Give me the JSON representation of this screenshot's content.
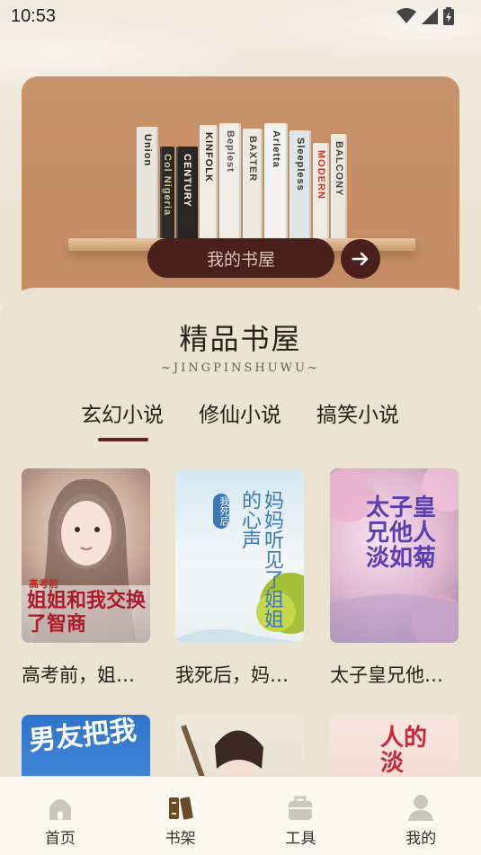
{
  "status_bar": {
    "time": "10:53"
  },
  "banner": {
    "button_label": "我的书屋",
    "books": [
      {
        "spine": "Union",
        "color": "#e9e6df",
        "text_color": "#222",
        "h": 126,
        "w": 24
      },
      {
        "spine": "Col Nigeria",
        "color": "#2c2a27",
        "text_color": "#d9c9a0",
        "h": 104,
        "w": 16
      },
      {
        "spine": "CENTURY",
        "color": "#2a2623",
        "text_color": "#ffffff",
        "h": 104,
        "w": 24
      },
      {
        "spine": "KINFOLK",
        "color": "#efece6",
        "text_color": "#222",
        "h": 128,
        "w": 20
      },
      {
        "spine": "Beplest",
        "color": "#f1eee8",
        "text_color": "#555",
        "h": 130,
        "w": 24
      },
      {
        "spine": "BAXTER",
        "color": "#ece9e2",
        "text_color": "#444",
        "h": 124,
        "w": 22
      },
      {
        "spine": "Arletta",
        "color": "#f4f2ee",
        "text_color": "#333",
        "h": 130,
        "w": 26
      },
      {
        "spine": "Sleepless",
        "color": "#dfe6e6",
        "text_color": "#333",
        "h": 122,
        "w": 24
      },
      {
        "spine": "MODERN",
        "color": "#f0ece3",
        "text_color": "#c23a2a",
        "h": 108,
        "w": 18
      },
      {
        "spine": "BALCONY",
        "color": "#ebe8e2",
        "text_color": "#444",
        "h": 118,
        "w": 18
      }
    ]
  },
  "section": {
    "title": "精品书屋",
    "subtitle": "~JINGPINSHUWU~"
  },
  "tabs": [
    {
      "label": "玄幻小说",
      "active": true
    },
    {
      "label": "修仙小说",
      "active": false
    },
    {
      "label": "搞笑小说",
      "active": false
    }
  ],
  "books": [
    {
      "title": "高考前，姐…",
      "cover_text": "姐姐和我交换了智商",
      "cover_sub": "高考前",
      "cover_bg": "#d9c6bf"
    },
    {
      "title": "我死后，妈…",
      "cover_text": "妈妈听见了姐姐的心声",
      "cover_sub": "我死后",
      "cover_bg": "#cfe2ee"
    },
    {
      "title": "太子皇兄他…",
      "cover_text": "太子皇兄他人淡如菊",
      "cover_sub": "",
      "cover_bg": "#e9d4e3"
    },
    {
      "title": "",
      "cover_text": "男友把我",
      "cover_sub": "",
      "cover_bg": "#3a7fd0"
    },
    {
      "title": "",
      "cover_text": "",
      "cover_sub": "",
      "cover_bg": "#e7e2d6"
    },
    {
      "title": "",
      "cover_text": "人的淡",
      "cover_sub": "",
      "cover_bg": "#f2d9cf"
    }
  ],
  "nav": [
    {
      "label": "首页",
      "icon": "home-icon",
      "active": false
    },
    {
      "label": "书架",
      "icon": "bookshelf-icon",
      "active": true
    },
    {
      "label": "工具",
      "icon": "toolbox-icon",
      "active": false
    },
    {
      "label": "我的",
      "icon": "profile-icon",
      "active": false
    }
  ],
  "colors": {
    "accent": "#4a1f1c",
    "banner": "#c8926a",
    "card_bg": "#ebe2d2",
    "nav_active": "#6b4a2a",
    "nav_inactive": "#c9c3bc"
  }
}
